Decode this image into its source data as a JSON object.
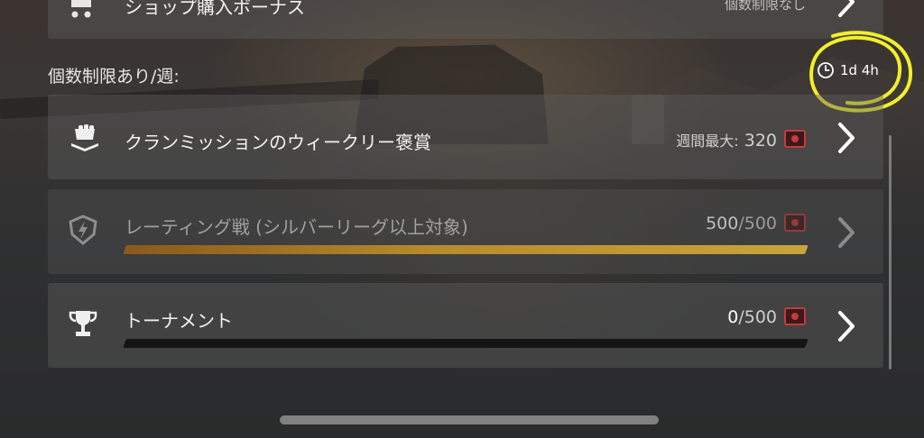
{
  "top_card": {
    "label": "ショップ購入ボーナス",
    "right_text": "個数制限なし"
  },
  "section": {
    "title": "個数制限あり/週:",
    "timer": "1d 4h"
  },
  "rows": [
    {
      "label": "クランミッションのウィークリー褒賞",
      "reward_prefix": "週間最大:",
      "reward_value": "320",
      "progress": null,
      "icon": "clan-fist-icon"
    },
    {
      "label": "レーティング戦 (シルバーリーグ以上対象)",
      "reward_value": "500",
      "reward_separator": "/",
      "reward_max": "500",
      "progress": 1.0,
      "icon": "rating-shield-icon"
    },
    {
      "label": "トーナメント",
      "reward_value": "0",
      "reward_separator": "/",
      "reward_max": "500",
      "progress": 0.0,
      "icon": "trophy-icon"
    }
  ],
  "colors": {
    "highlight": "#f2ef2a",
    "progress_fill": "#c9a43a",
    "ticket": "#c83a3a"
  }
}
